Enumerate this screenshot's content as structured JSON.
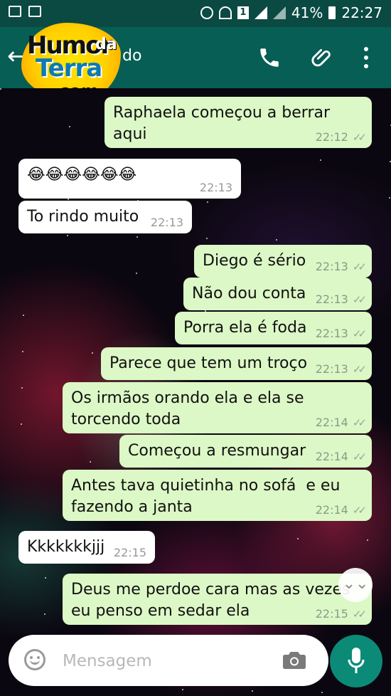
{
  "status_bar": {
    "battery": "41%",
    "time": "22:27",
    "sim": "1"
  },
  "app_bar": {
    "contact_name_partial": "do"
  },
  "logo": {
    "line1": "Humor",
    "line1b": "da",
    "line2": "Terra",
    "line3": ".com"
  },
  "messages": [
    {
      "dir": "out",
      "text": "Raphaela começou a berrar aqui",
      "time": "22:12",
      "ticks": "✓✓"
    },
    {
      "dir": "in",
      "text": "😂😂😂😂😂😂",
      "time": "22:13"
    },
    {
      "dir": "in",
      "text": "To rindo muito",
      "time": "22:13"
    },
    {
      "dir": "out",
      "text": "Diego é sério",
      "time": "22:13",
      "ticks": "✓✓"
    },
    {
      "dir": "out",
      "text": "Não dou conta",
      "time": "22:13",
      "ticks": "✓✓"
    },
    {
      "dir": "out",
      "text": "Porra ela é foda",
      "time": "22:13",
      "ticks": "✓✓"
    },
    {
      "dir": "out",
      "text": "Parece que tem um troço",
      "time": "22:13",
      "ticks": "✓✓"
    },
    {
      "dir": "out",
      "text": "Os irmãos orando ela e ela se\ntorcendo toda",
      "time": "22:14",
      "ticks": "✓✓"
    },
    {
      "dir": "out",
      "text": "Começou a resmungar",
      "time": "22:14",
      "ticks": "✓✓"
    },
    {
      "dir": "out",
      "text": "Antes tava quietinha no sofá  e eu\nfazendo a janta",
      "time": "22:14",
      "ticks": "✓✓"
    },
    {
      "dir": "in",
      "text": "Kkkkkkkjjj",
      "time": "22:15"
    },
    {
      "dir": "out",
      "text": "Deus me perdoe cara mas as vezes\neu penso em sedar ela",
      "time": "22:15",
      "ticks": "✓✓"
    }
  ],
  "input": {
    "placeholder": "Mensagem"
  },
  "colors": {
    "header": "#075e54",
    "status": "#0a4a42",
    "outgoing": "#dcf8c6",
    "incoming": "#ffffff",
    "fab": "#0b8a78"
  }
}
